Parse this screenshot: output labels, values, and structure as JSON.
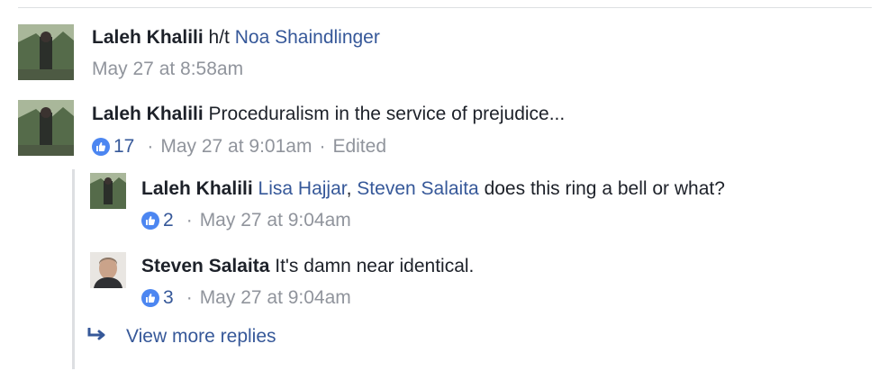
{
  "comments": [
    {
      "author": "Laleh Khalili",
      "prefix": "h/t",
      "mention": "Noa Shaindlinger",
      "timestamp": "May 27 at 8:58am"
    },
    {
      "author": "Laleh Khalili",
      "text": "Proceduralism in the service of prejudice...",
      "likes": "17",
      "timestamp": "May 27 at 9:01am",
      "edited": "Edited"
    }
  ],
  "replies": [
    {
      "author": "Laleh Khalili",
      "mention1": "Lisa Hajjar",
      "comma": ",",
      "mention2": "Steven Salaita",
      "text": "does this ring a bell or what?",
      "likes": "2",
      "timestamp": "May 27 at 9:04am"
    },
    {
      "author": "Steven Salaita",
      "text": "It's damn near identical.",
      "likes": "3",
      "timestamp": "May 27 at 9:04am"
    }
  ],
  "more_replies": {
    "label": "View more replies",
    "icon": "reply-arrow-icon"
  },
  "separator": "·",
  "colors": {
    "link": "#365899",
    "meta": "#90949c",
    "like_badge": "#4c86f1",
    "text": "#1d2129"
  }
}
